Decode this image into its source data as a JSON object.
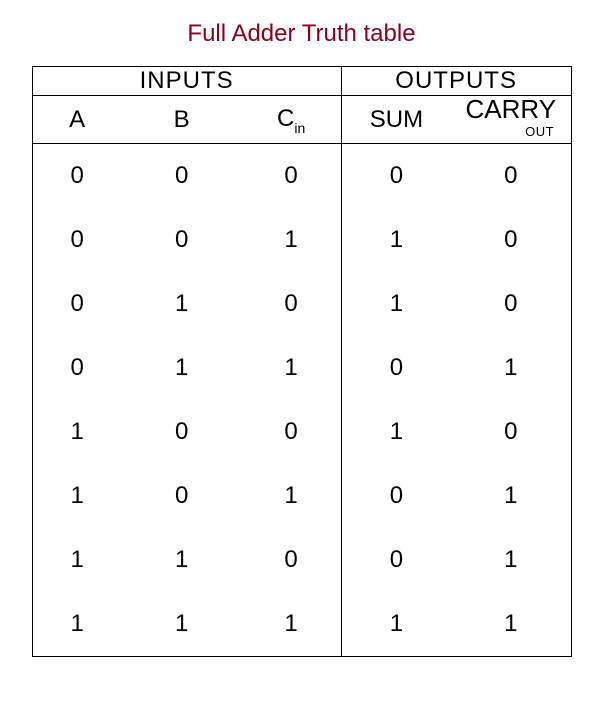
{
  "title": "Full Adder Truth table",
  "group_headers": {
    "inputs": "INPUTS",
    "outputs": "OUTPUTS"
  },
  "columns": {
    "a": "A",
    "b": "B",
    "cin_main": "C",
    "cin_sub": "in",
    "sum": "SUM",
    "carry_main": "CARRY",
    "carry_sub": "OUT"
  },
  "rows": [
    {
      "a": "0",
      "b": "0",
      "cin": "0",
      "sum": "0",
      "carry": "0"
    },
    {
      "a": "0",
      "b": "0",
      "cin": "1",
      "sum": "1",
      "carry": "0"
    },
    {
      "a": "0",
      "b": "1",
      "cin": "0",
      "sum": "1",
      "carry": "0"
    },
    {
      "a": "0",
      "b": "1",
      "cin": "1",
      "sum": "0",
      "carry": "1"
    },
    {
      "a": "1",
      "b": "0",
      "cin": "0",
      "sum": "1",
      "carry": "0"
    },
    {
      "a": "1",
      "b": "0",
      "cin": "1",
      "sum": "0",
      "carry": "1"
    },
    {
      "a": "1",
      "b": "1",
      "cin": "0",
      "sum": "0",
      "carry": "1"
    },
    {
      "a": "1",
      "b": "1",
      "cin": "1",
      "sum": "1",
      "carry": "1"
    }
  ],
  "chart_data": {
    "type": "table",
    "title": "Full Adder Truth table",
    "columns": [
      "A",
      "B",
      "Cin",
      "SUM",
      "CARRY OUT"
    ],
    "rows": [
      [
        0,
        0,
        0,
        0,
        0
      ],
      [
        0,
        0,
        1,
        1,
        0
      ],
      [
        0,
        1,
        0,
        1,
        0
      ],
      [
        0,
        1,
        1,
        0,
        1
      ],
      [
        1,
        0,
        0,
        1,
        0
      ],
      [
        1,
        0,
        1,
        0,
        1
      ],
      [
        1,
        1,
        0,
        0,
        1
      ],
      [
        1,
        1,
        1,
        1,
        1
      ]
    ]
  }
}
